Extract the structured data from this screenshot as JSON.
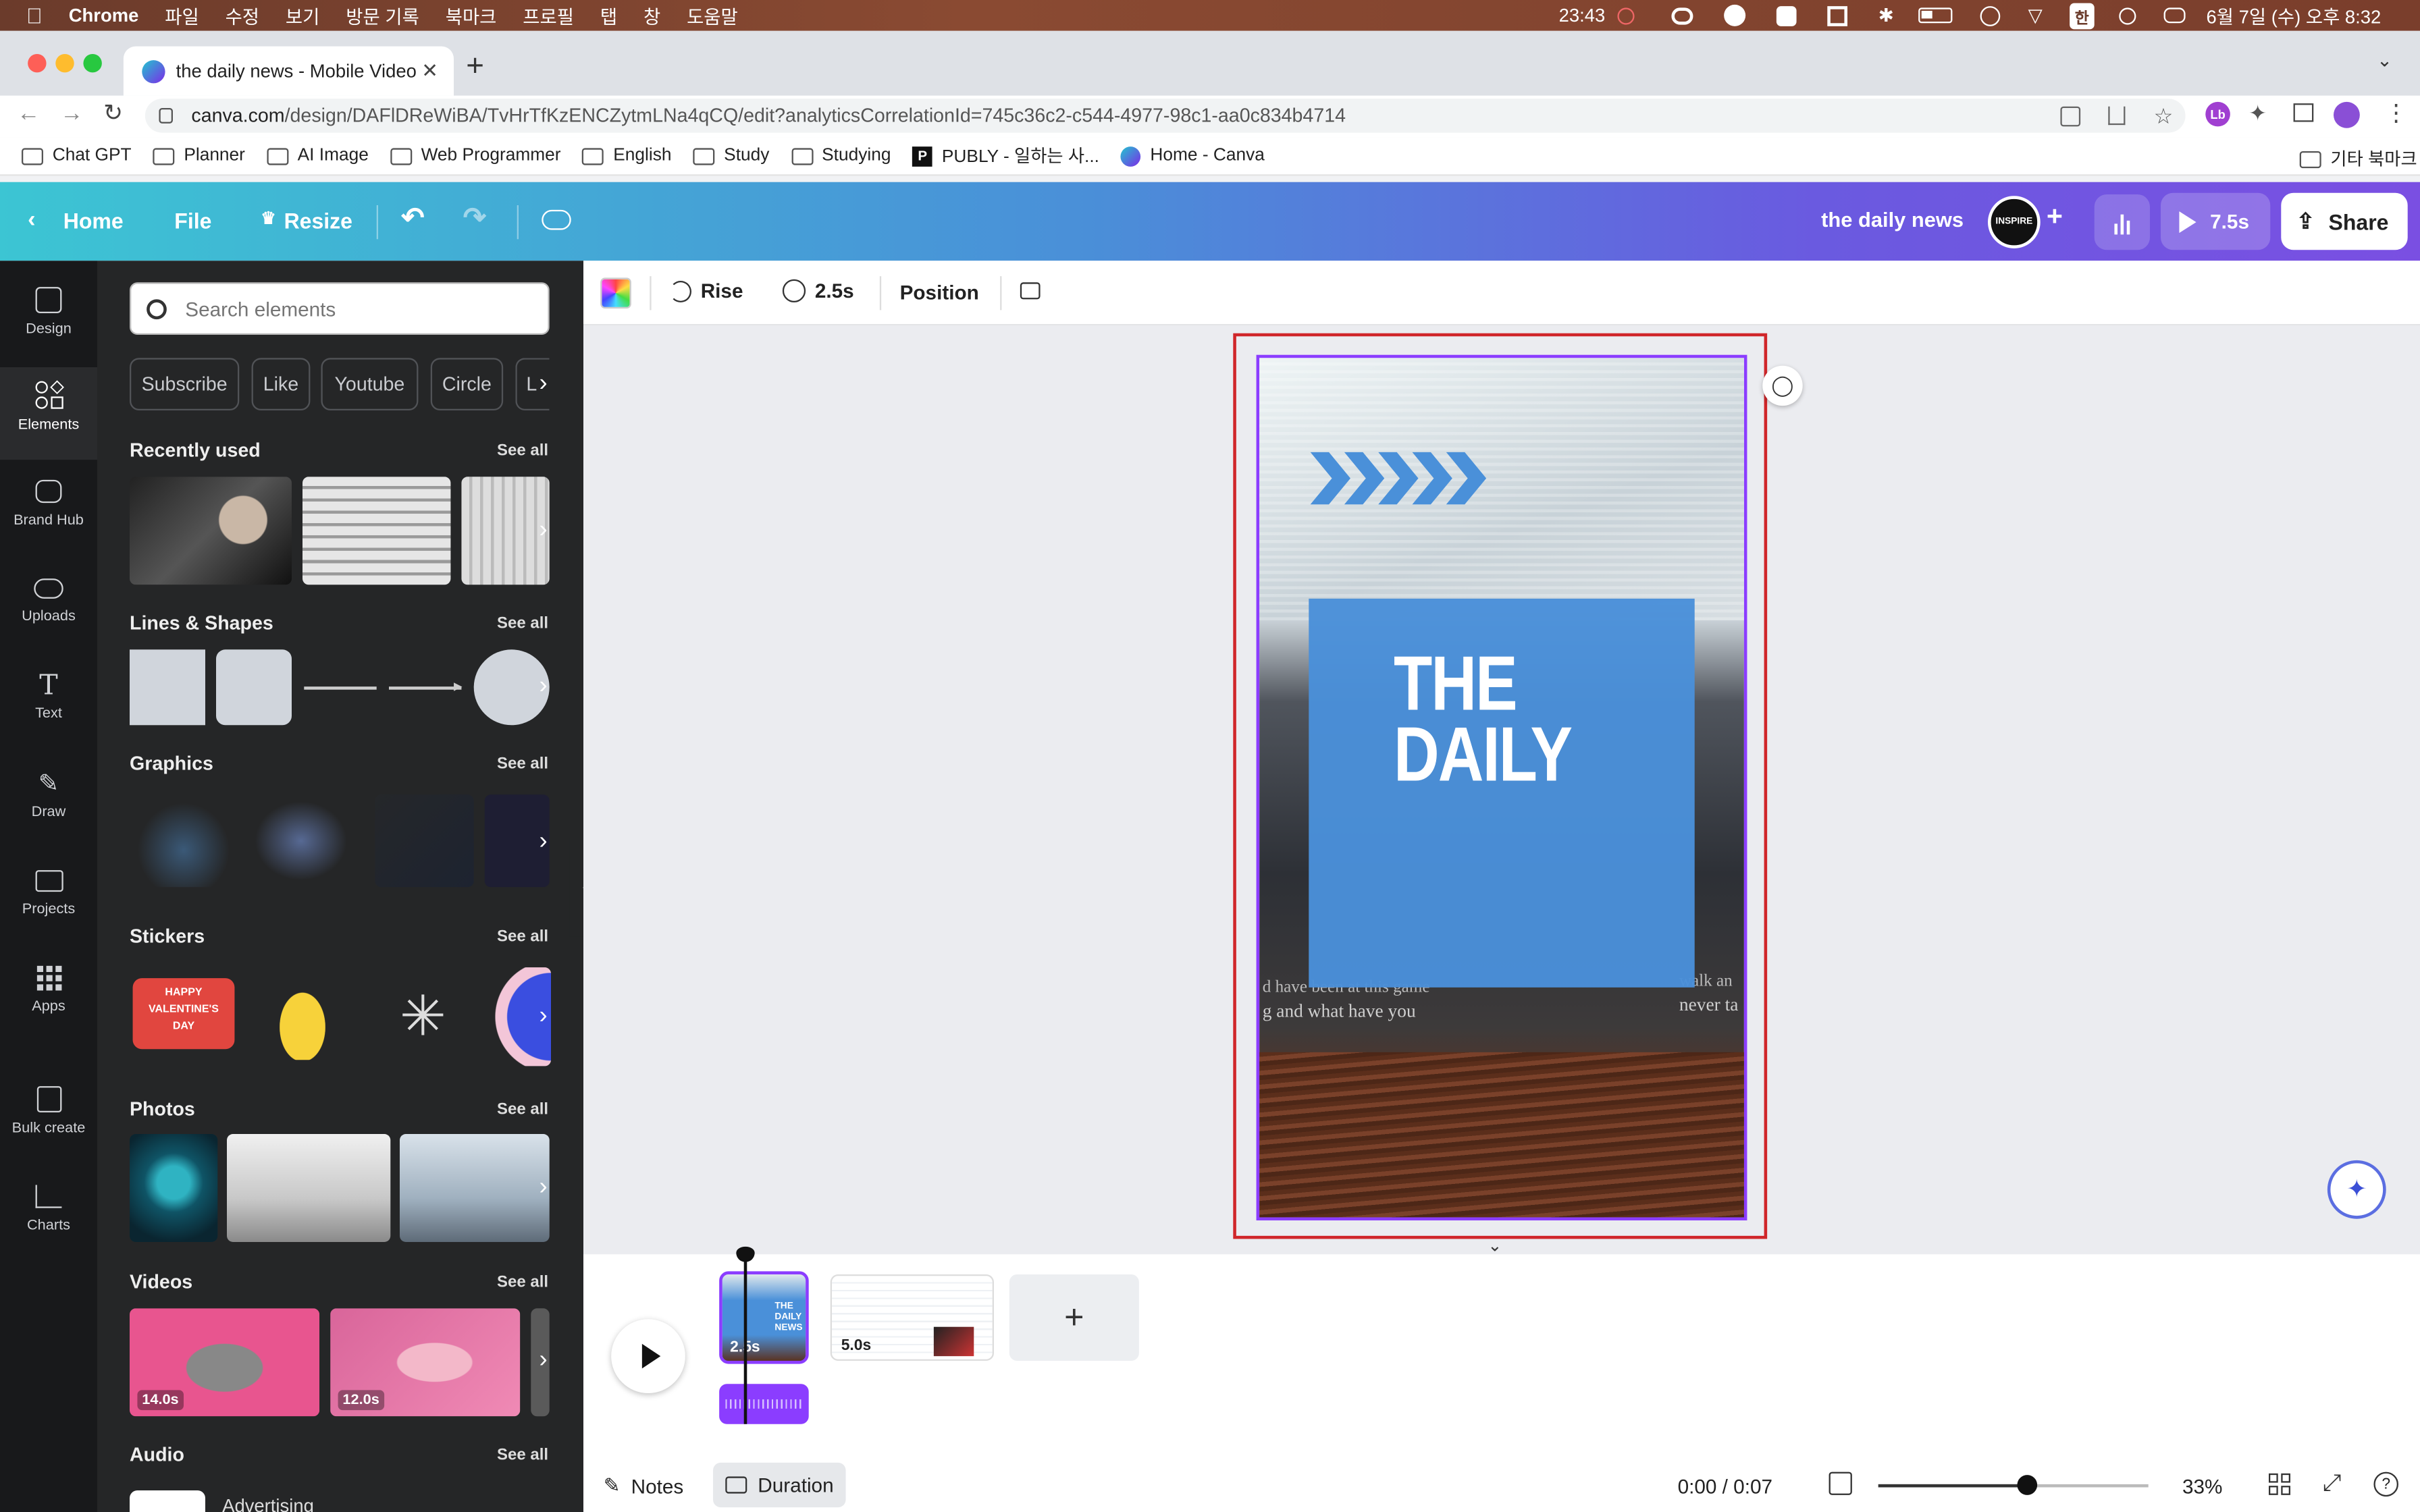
{
  "menubar": {
    "app": "Chrome",
    "menus": [
      "파일",
      "수정",
      "보기",
      "방문 기록",
      "북마크",
      "프로필",
      "탭",
      "창",
      "도움말"
    ],
    "time": "23:43",
    "datetime": "6월 7일 (수) 오후 8:32",
    "input_method": "한"
  },
  "browser": {
    "tab_title": "the daily news - Mobile Video",
    "new_tab": "+",
    "url_domain": "canva.com",
    "url_path": "/design/DAFlDReWiBA/TvHrTfKzENCZytmLNa4qCQ/edit?analyticsCorrelationId=745c36c2-c544-4977-98c1-aa0c834b4714",
    "bookmarks": [
      "Chat GPT",
      "Planner",
      "AI Image",
      "Web Programmer",
      "English",
      "Study",
      "Studying",
      "PUBLY - 일하는 사...",
      "Home - Canva"
    ],
    "other_bookmarks": "기타 북마크",
    "profile_initial": "Lb"
  },
  "header": {
    "home": "Home",
    "file": "File",
    "resize": "Resize",
    "design_title": "the daily news",
    "play_duration": "7.5s",
    "share": "Share",
    "avatar_text": "INSPIRE"
  },
  "rail": [
    {
      "label": "Design",
      "icon": "design-icon"
    },
    {
      "label": "Elements",
      "icon": "elements-icon"
    },
    {
      "label": "Brand Hub",
      "icon": "brand-hub-icon"
    },
    {
      "label": "Uploads",
      "icon": "uploads-icon"
    },
    {
      "label": "Text",
      "icon": "text-icon"
    },
    {
      "label": "Draw",
      "icon": "draw-icon"
    },
    {
      "label": "Projects",
      "icon": "projects-icon"
    },
    {
      "label": "Apps",
      "icon": "apps-icon"
    },
    {
      "label": "Bulk create",
      "icon": "bulk-create-icon"
    },
    {
      "label": "Charts",
      "icon": "charts-icon"
    }
  ],
  "panel": {
    "search_placeholder": "Search elements",
    "chips": [
      "Subscribe",
      "Like",
      "Youtube",
      "Circle",
      "L"
    ],
    "see_all": "See all",
    "sections": {
      "recently_used": "Recently used",
      "lines_shapes": "Lines & Shapes",
      "graphics": "Graphics",
      "stickers": "Stickers",
      "photos": "Photos",
      "videos": "Videos",
      "audio": "Audio"
    },
    "sticker_text": [
      "HAPPY",
      "VALENTINE'S",
      "DAY"
    ],
    "video_durations": [
      "14.0s",
      "12.0s"
    ],
    "audio_first": "Advertising"
  },
  "canvas_toolbar": {
    "animation": "Rise",
    "duration": "2.5s",
    "position": "Position"
  },
  "design": {
    "headline_line1": "THE",
    "headline_line2": "DAILY",
    "paper_text_1": "g and what have you",
    "paper_text_2": "never ta",
    "paper_text_3": "walk an",
    "paper_text_4": "d have been at this game"
  },
  "timeline": {
    "page1_duration": "2.5s",
    "page2_duration": "5.0s",
    "add_page": "+",
    "page1_text": [
      "THE",
      "DAILY",
      "NEWS"
    ]
  },
  "footer": {
    "notes": "Notes",
    "duration": "Duration",
    "time": "0:00 / 0:07",
    "zoom": "33%",
    "zoom_level": 0.33
  },
  "colors": {
    "accent_purple": "#8b3dff",
    "selection_red": "#d0262a",
    "headline_box": "#4a90d9"
  }
}
